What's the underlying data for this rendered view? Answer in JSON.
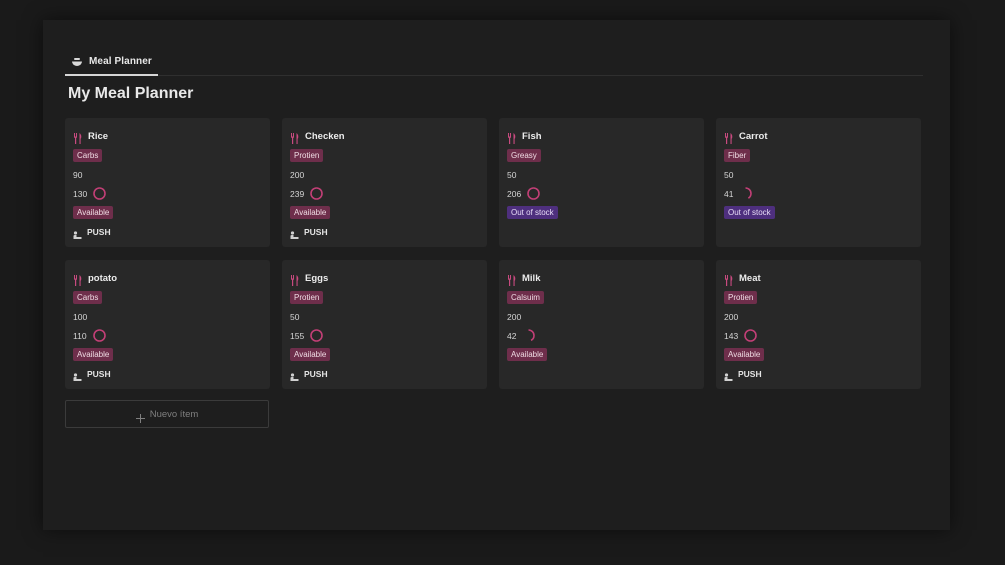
{
  "tab": {
    "label": "Meal Planner",
    "icon": "bowl-icon"
  },
  "page": {
    "title": "My Meal Planner"
  },
  "colors": {
    "tag_pink": "#6e2e4b",
    "tag_purple": "#4e2f7e",
    "ring": "#c23f76"
  },
  "cards": [
    {
      "name": "Rice",
      "category": "Carbs",
      "value": "90",
      "calories": "130",
      "progress": 1.0,
      "status": "Available",
      "status_color": "pink",
      "push": "PUSH"
    },
    {
      "name": "Checken",
      "category": "Protien",
      "value": "200",
      "calories": "239",
      "progress": 1.0,
      "status": "Available",
      "status_color": "pink",
      "push": "PUSH"
    },
    {
      "name": "Fish",
      "category": "Greasy",
      "value": "50",
      "calories": "206",
      "progress": 1.0,
      "status": "Out of stock",
      "status_color": "purple",
      "push": ""
    },
    {
      "name": "Carrot",
      "category": "Fiber",
      "value": "50",
      "calories": "41",
      "progress": 0.41,
      "status": "Out of stock",
      "status_color": "purple",
      "push": ""
    },
    {
      "name": "potato",
      "category": "Carbs",
      "value": "100",
      "calories": "110",
      "progress": 1.0,
      "status": "Available",
      "status_color": "pink",
      "push": "PUSH"
    },
    {
      "name": "Eggs",
      "category": "Protien",
      "value": "50",
      "calories": "155",
      "progress": 1.0,
      "status": "Available",
      "status_color": "pink",
      "push": "PUSH"
    },
    {
      "name": "Milk",
      "category": "Calsuim",
      "value": "200",
      "calories": "42",
      "progress": 0.42,
      "status": "Available",
      "status_color": "pink",
      "push": ""
    },
    {
      "name": "Meat",
      "category": "Protien",
      "value": "200",
      "calories": "143",
      "progress": 1.0,
      "status": "Available",
      "status_color": "pink",
      "push": "PUSH"
    }
  ],
  "new_item": {
    "label": "Nuevo ítem",
    "icon": "plus-icon"
  }
}
